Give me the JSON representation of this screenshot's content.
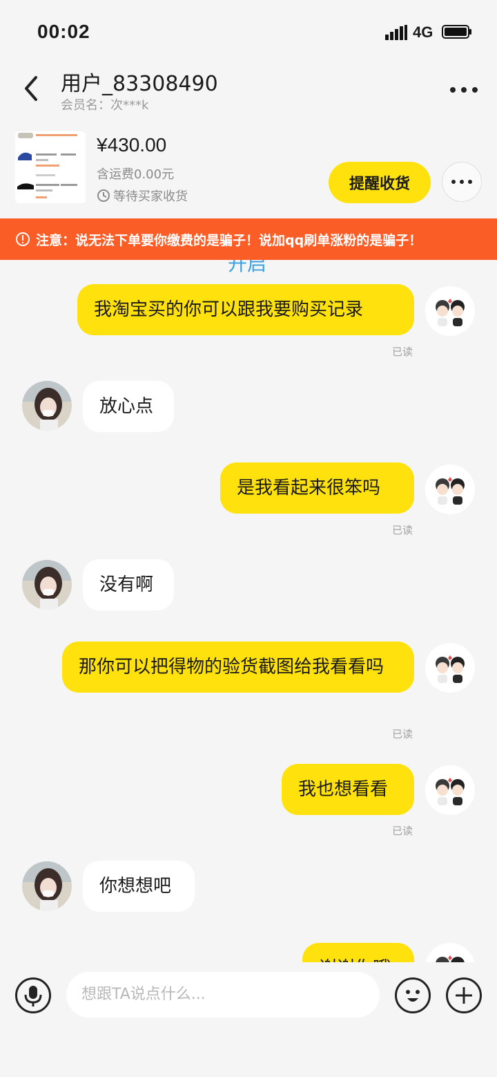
{
  "status_bar": {
    "time": "00:02",
    "network": "4G"
  },
  "header": {
    "title": "用户_83308490",
    "subtitle": "会员名：次***k"
  },
  "order": {
    "price": "¥430.00",
    "shipping": "含运费0.00元",
    "status": "等待买家收货",
    "remind_label": "提醒收货"
  },
  "warning": {
    "text": "注意：说无法下单要你缴费的是骗子！说加qq刷单涨粉的是骗子！"
  },
  "chat": {
    "peek_text": "开启",
    "read_label": "已读",
    "messages": [
      {
        "side": "me",
        "text": "我淘宝买的你可以跟我要购买记录",
        "read": true
      },
      {
        "side": "them",
        "text": "放心点"
      },
      {
        "side": "me",
        "text": "是我看起来很笨吗",
        "read": true
      },
      {
        "side": "them",
        "text": "没有啊"
      },
      {
        "side": "me",
        "text": "那你可以把得物的验货截图给我看看吗",
        "read": true
      },
      {
        "side": "me",
        "text": "我也想看看",
        "read": true
      },
      {
        "side": "them",
        "text": "你想想吧"
      },
      {
        "side": "me",
        "text": "谢谢你哦"
      }
    ]
  },
  "input": {
    "placeholder": "想跟TA说点什么..."
  },
  "colors": {
    "accent": "#ffe20d",
    "warning": "#fb5d27",
    "background": "#f5f5f5"
  }
}
